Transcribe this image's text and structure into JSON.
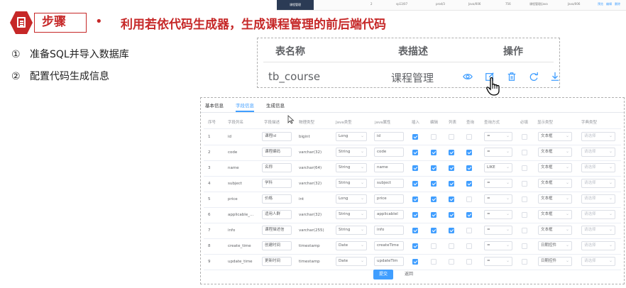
{
  "top_strip": {
    "tab_label": "课程管理",
    "cells": [
      "2",
      "sp13/07",
      "prod/3",
      "Java/006",
      "756",
      "课程管理/java",
      "Java/006"
    ],
    "links": [
      "预览",
      "编辑",
      "删除"
    ]
  },
  "slide": {
    "step_label": "步骤",
    "bullet": "•",
    "heading": "利用若依代码生成器，生成课程管理的前后端代码",
    "steps": [
      {
        "num": "①",
        "text": "准备SQL并导入数据库"
      },
      {
        "num": "②",
        "text": "配置代码生成信息"
      }
    ]
  },
  "preview_table": {
    "headers": {
      "name": "表名称",
      "desc": "表描述",
      "ops": "操作"
    },
    "row": {
      "name": "tb_course",
      "desc": "课程管理"
    },
    "icons": [
      "eye-icon",
      "edit-icon",
      "trash-icon",
      "refresh-icon",
      "download-icon"
    ]
  },
  "editor": {
    "tabs": [
      "基本信息",
      "字段信息",
      "生成信息"
    ],
    "active_tab": "字段信息",
    "columns": [
      "序号",
      "字段列名",
      "字段描述",
      "物理类型",
      "Java类型",
      "java属性",
      "插入",
      "编辑",
      "列表",
      "查询",
      "查询方式",
      "必填",
      "显示类型",
      "字典类型"
    ],
    "rows": [
      {
        "no": "1",
        "col": "id",
        "desc": "课程id",
        "ptype": "bigint",
        "jtype": "Long",
        "prop": "id",
        "ins": true,
        "edit": false,
        "list": false,
        "query": false,
        "qop": "=",
        "req": false,
        "show": "文本框",
        "dict": "请选择"
      },
      {
        "no": "2",
        "col": "code",
        "desc": "课程编码",
        "ptype": "varchar(32)",
        "jtype": "String",
        "prop": "code",
        "ins": true,
        "edit": true,
        "list": true,
        "query": true,
        "qop": "=",
        "req": false,
        "show": "文本框",
        "dict": "请选择"
      },
      {
        "no": "3",
        "col": "name",
        "desc": "名称",
        "ptype": "varchar(64)",
        "jtype": "String",
        "prop": "name",
        "ins": true,
        "edit": true,
        "list": true,
        "query": true,
        "qop": "LIKE",
        "req": false,
        "show": "文本框",
        "dict": "请选择"
      },
      {
        "no": "4",
        "col": "subject",
        "desc": "学科",
        "ptype": "varchar(32)",
        "jtype": "String",
        "prop": "subject",
        "ins": true,
        "edit": true,
        "list": true,
        "query": true,
        "qop": "=",
        "req": false,
        "show": "文本框",
        "dict": "请选择"
      },
      {
        "no": "5",
        "col": "price",
        "desc": "价格",
        "ptype": "int",
        "jtype": "Long",
        "prop": "price",
        "ins": true,
        "edit": true,
        "list": true,
        "query": false,
        "qop": "=",
        "req": false,
        "show": "文本框",
        "dict": "请选择"
      },
      {
        "no": "6",
        "col": "applicable_...",
        "desc": "适用人群",
        "ptype": "varchar(32)",
        "jtype": "String",
        "prop": "applicablel",
        "ins": true,
        "edit": true,
        "list": true,
        "query": true,
        "qop": "=",
        "req": false,
        "show": "文本框",
        "dict": "请选择"
      },
      {
        "no": "7",
        "col": "info",
        "desc": "课程描述信",
        "ptype": "varchar(255)",
        "jtype": "String",
        "prop": "info",
        "ins": true,
        "edit": true,
        "list": true,
        "query": false,
        "qop": "=",
        "req": false,
        "show": "文本框",
        "dict": "请选择"
      },
      {
        "no": "8",
        "col": "create_time",
        "desc": "创建时间",
        "ptype": "timestamp",
        "jtype": "Date",
        "prop": "createTime",
        "ins": true,
        "edit": false,
        "list": false,
        "query": false,
        "qop": "=",
        "req": false,
        "show": "日期控件",
        "dict": "请选择"
      },
      {
        "no": "9",
        "col": "update_time",
        "desc": "更新时间",
        "ptype": "timestamp",
        "jtype": "Date",
        "prop": "updateTim",
        "ins": true,
        "edit": false,
        "list": false,
        "query": false,
        "qop": "=",
        "req": false,
        "show": "日期控件",
        "dict": "请选择"
      }
    ],
    "submit_label": "提交",
    "back_label": "返回"
  },
  "colors": {
    "accent": "#c62828",
    "primary": "#409eff"
  }
}
